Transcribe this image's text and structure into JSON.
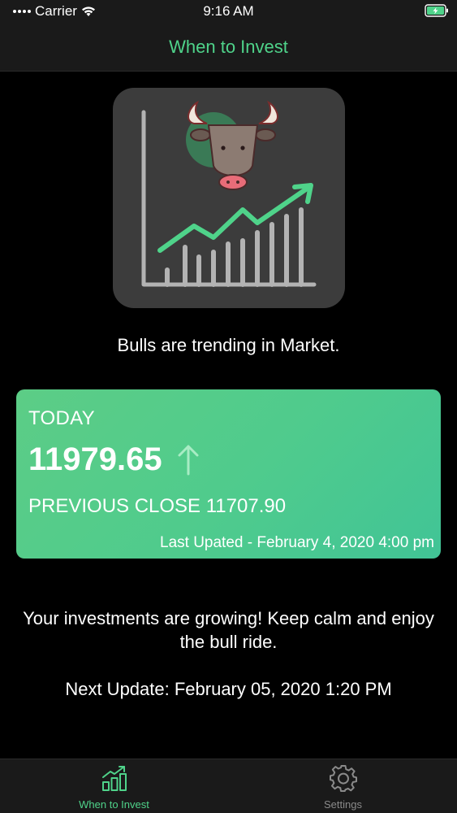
{
  "status_bar": {
    "carrier": "Carrier",
    "time": "9:16 AM"
  },
  "nav": {
    "title": "When to Invest"
  },
  "hero": {
    "icon": "bull-market-chart-icon"
  },
  "trend_text": "Bulls are trending in Market.",
  "card": {
    "label": "TODAY",
    "value": "11979.65",
    "direction_icon": "arrow-up-icon",
    "previous_close": "PREVIOUS CLOSE 11707.90",
    "last_updated": "Last Upated - February 4, 2020 4:00 pm"
  },
  "message": "Your investments are growing! Keep calm and enjoy the bull ride.",
  "next_update": "Next Update: February 05, 2020 1:20 PM",
  "tabs": [
    {
      "label": "When to Invest",
      "icon": "chart-growth-icon",
      "active": true
    },
    {
      "label": "Settings",
      "icon": "gear-icon",
      "active": false
    }
  ],
  "colors": {
    "accent": "#4fd38a",
    "card": "#4fcb8d",
    "background": "#000000"
  }
}
